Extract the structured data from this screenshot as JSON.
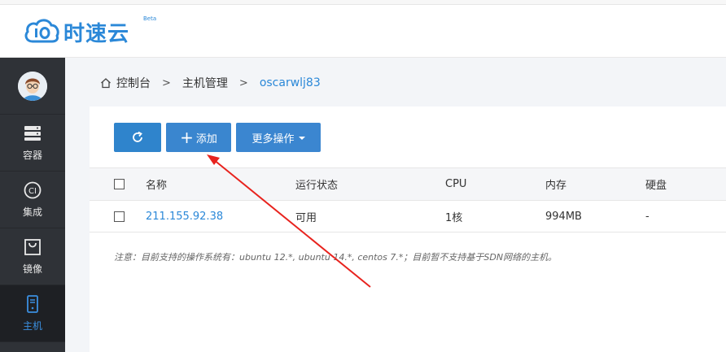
{
  "header": {
    "logo_text": "时速云",
    "logo_badge": "Beta"
  },
  "sidebar": {
    "items": [
      {
        "label": "容器",
        "icon": "server-stack-icon",
        "active": false
      },
      {
        "label": "集成",
        "icon": "ci-icon",
        "active": false
      },
      {
        "label": "镜像",
        "icon": "image-bag-icon",
        "active": false
      },
      {
        "label": "主机",
        "icon": "host-icon",
        "active": true
      }
    ]
  },
  "breadcrumb": {
    "home": "控制台",
    "section": "主机管理",
    "current": "oscarwlj83"
  },
  "toolbar": {
    "add_label": "添加",
    "more_label": "更多操作"
  },
  "table": {
    "columns": [
      "名称",
      "运行状态",
      "CPU",
      "内存",
      "硬盘"
    ],
    "rows": [
      {
        "name": "211.155.92.38",
        "status": "可用",
        "cpu": "1核",
        "memory": "994MB",
        "disk": "-"
      }
    ]
  },
  "note": "注意：目前支持的操作系统有：ubuntu 12.*, ubuntu 14.*, centos 7.*；目前暂不支持基于SDN网络的主机。",
  "colors": {
    "accent": "#2f84cc",
    "sidebar_bg": "#2f3237",
    "active_nav": "#3b8fe0",
    "annotation_arrow": "#e8231e"
  }
}
